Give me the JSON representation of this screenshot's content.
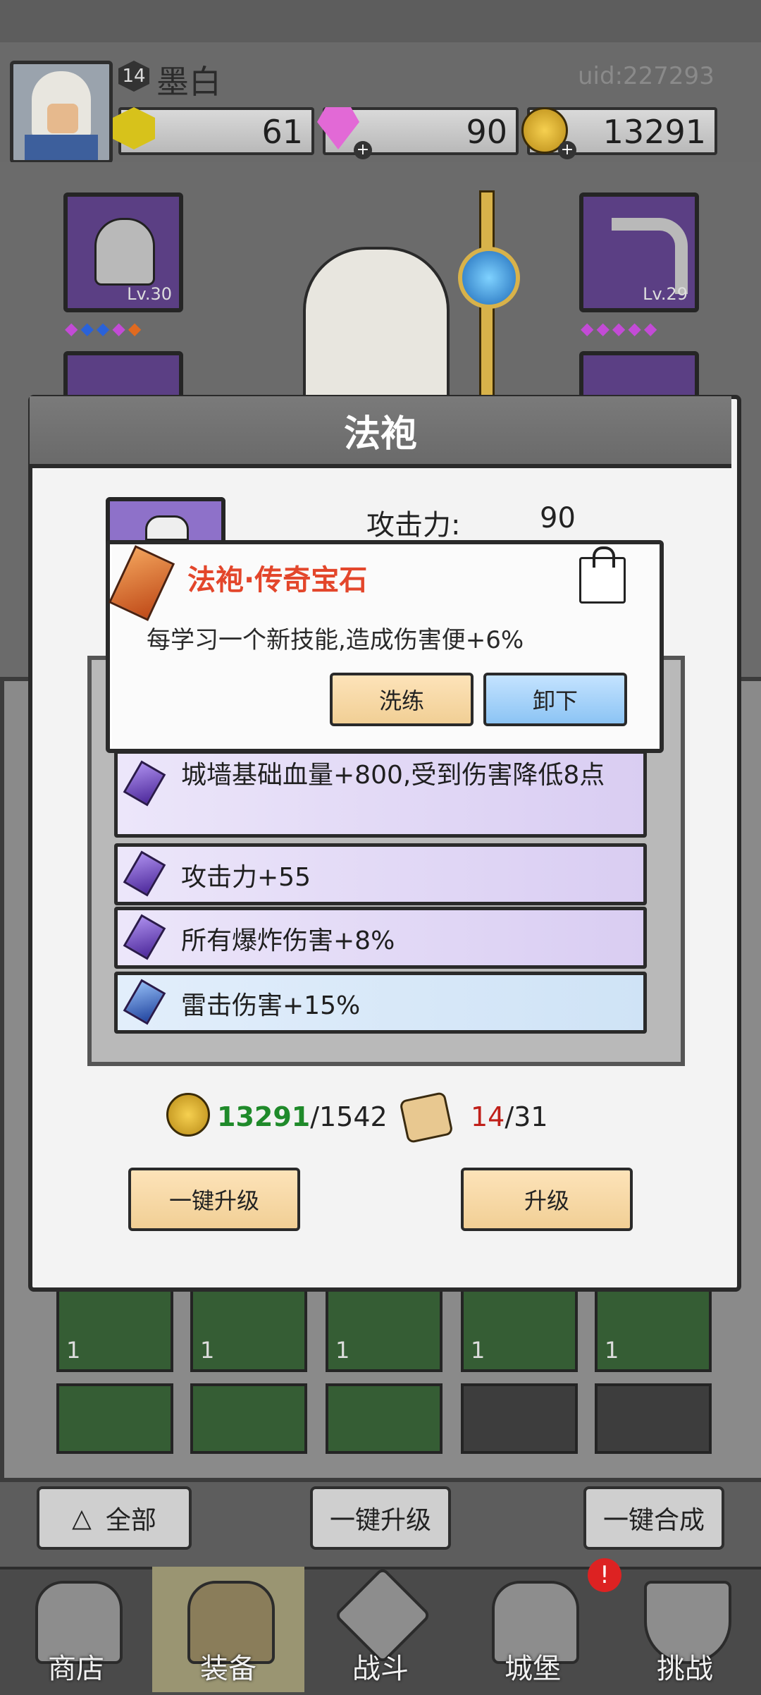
{
  "player": {
    "level": "14",
    "name": "墨白",
    "uid": "uid:227293"
  },
  "resources": [
    {
      "name": "gold-hex",
      "value": "61"
    },
    {
      "name": "gem",
      "value": "90"
    },
    {
      "name": "coin",
      "value": "13291"
    }
  ],
  "equipment": {
    "left_top_level": "Lv.30",
    "right_top_level": "Lv.29"
  },
  "modal": {
    "title": "法袍",
    "attack_label": "攻击力:",
    "attack_value": "90",
    "tooltip": {
      "title": "法袍·传奇宝石",
      "description": "每学习一个新技能,造成伤害便+6%",
      "refine_label": "洗练",
      "unequip_label": "卸下"
    },
    "attributes": [
      {
        "text": "城墙基础血量+800,受到伤害降低8点"
      },
      {
        "text": "攻击力+55"
      },
      {
        "text": "所有爆炸伤害+8%"
      },
      {
        "text": "雷击伤害+15%"
      }
    ],
    "cost": {
      "coin_have": "13291",
      "coin_need": "/1542",
      "scroll_have": "14",
      "scroll_need": "/31"
    },
    "one_key_upgrade_label": "一键升级",
    "upgrade_label": "升级"
  },
  "inventory": {
    "gem_count": "1"
  },
  "bottom_buttons": {
    "filter_label": "全部",
    "upgrade_all_label": "一键升级",
    "merge_all_label": "一键合成"
  },
  "nav": [
    {
      "label": "商店"
    },
    {
      "label": "装备"
    },
    {
      "label": "战斗"
    },
    {
      "label": "城堡"
    },
    {
      "label": "挑战"
    }
  ],
  "colors": {
    "accent_red": "#e3462b",
    "coin_green": "#1f8a2a",
    "scroll_red": "#c0201a"
  }
}
